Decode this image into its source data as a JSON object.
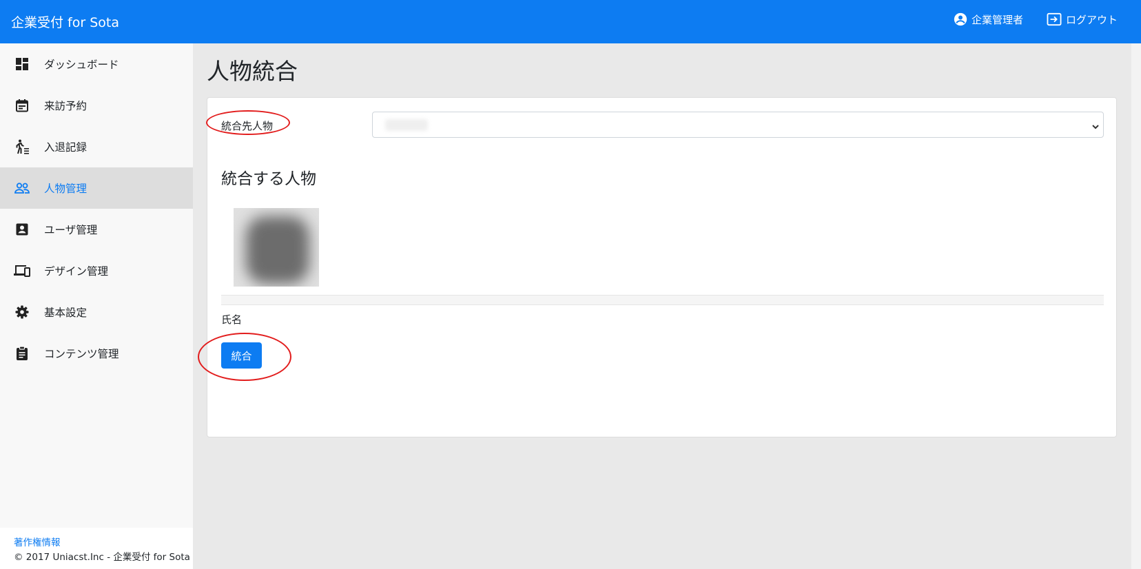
{
  "app": {
    "title": "企業受付 for Sota"
  },
  "header": {
    "user_label": "企業管理者",
    "logout_label": "ログアウト"
  },
  "sidebar": {
    "items": [
      {
        "label": "ダッシュボード",
        "icon": "dashboard-icon"
      },
      {
        "label": "来訪予約",
        "icon": "calendar-icon"
      },
      {
        "label": "入退記録",
        "icon": "walking-log-icon"
      },
      {
        "label": "人物管理",
        "icon": "people-icon",
        "active": true
      },
      {
        "label": "ユーザ管理",
        "icon": "account-box-icon"
      },
      {
        "label": "デザイン管理",
        "icon": "devices-icon"
      },
      {
        "label": "基本設定",
        "icon": "gear-icon"
      },
      {
        "label": "コンテンツ管理",
        "icon": "clipboard-icon"
      }
    ],
    "footer": {
      "link_label": "著作権情報",
      "copyright": "© 2017 Uniacst.Inc - 企業受付 for Sota"
    }
  },
  "main": {
    "page_title": "人物統合",
    "form": {
      "target_label": "統合先人物",
      "section_title": "統合する人物",
      "name_label": "氏名",
      "submit_label": "統合"
    }
  },
  "colors": {
    "primary": "#0d7cf2",
    "annotation": "#e21c1c",
    "active_bg": "#dddddd"
  }
}
